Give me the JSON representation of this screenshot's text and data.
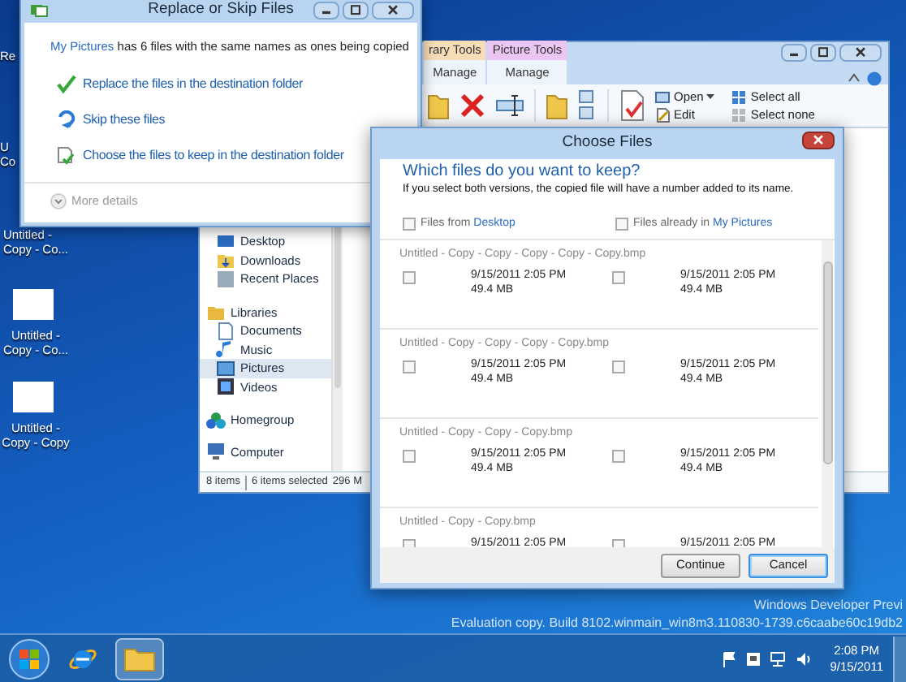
{
  "desktop": {
    "icons": [
      {
        "lines": [
          "Re"
        ]
      },
      {
        "lines": [
          "U",
          "Co"
        ]
      },
      {
        "lines": [
          "Untitled -",
          "Copy - Co..."
        ]
      },
      {
        "lines": [
          "Untitled -",
          "Copy - Co..."
        ]
      },
      {
        "lines": [
          "Untitled -",
          "Copy - Copy"
        ]
      }
    ],
    "watermark": [
      "Windows Developer Previ",
      "Evaluation copy. Build 8102.winmain_win8m3.110830-1739.c6caabe60c19db2"
    ]
  },
  "explorer": {
    "context_tabs": [
      {
        "label": "rary Tools",
        "color": "#f7dcb8",
        "group": "Manage"
      },
      {
        "label": "Picture Tools",
        "color": "#ecc6f2",
        "group": "Manage"
      }
    ],
    "ribbon": [
      {
        "kind": "open",
        "label": "Open"
      },
      {
        "kind": "edit",
        "label": "Edit"
      },
      {
        "kind": "select_all",
        "label": "Select all"
      },
      {
        "kind": "select_none",
        "label": "Select none"
      }
    ],
    "nav": [
      {
        "kind": "desktop",
        "label": "Desktop",
        "selected": false
      },
      {
        "kind": "downloads",
        "label": "Downloads",
        "selected": false
      },
      {
        "kind": "recent",
        "label": "Recent Places",
        "selected": false
      },
      {
        "kind": "libraries",
        "label": "Libraries",
        "selected": false
      },
      {
        "kind": "documents",
        "label": "Documents",
        "selected": false
      },
      {
        "kind": "music",
        "label": "Music",
        "selected": false
      },
      {
        "kind": "pictures",
        "label": "Pictures",
        "selected": true
      },
      {
        "kind": "videos",
        "label": "Videos",
        "selected": false
      },
      {
        "kind": "homegroup",
        "label": "Homegroup",
        "selected": false
      },
      {
        "kind": "computer",
        "label": "Computer",
        "selected": false
      }
    ],
    "status": [
      "8 items",
      "6 items selected",
      "296 M"
    ]
  },
  "replace_dialog": {
    "title": "Replace or Skip Files",
    "message_link": "My Pictures",
    "message": " has 6 files with the same names as ones being copied",
    "options": [
      {
        "kind": "replace",
        "label": "Replace the files in the destination folder"
      },
      {
        "kind": "skip",
        "label": "Skip these files"
      },
      {
        "kind": "choose",
        "label": "Choose the files to keep in the destination folder"
      }
    ],
    "more_details": "More details"
  },
  "choose_dialog": {
    "title": "Choose Files",
    "heading": "Which files do you want to keep?",
    "subtitle": "If you select both versions, the copied file will have a number added to its name.",
    "columns": [
      {
        "prefix": "Files from ",
        "link": "Desktop",
        "checked": false
      },
      {
        "prefix": "Files already in ",
        "link": "My Pictures",
        "checked": false
      }
    ],
    "files": [
      {
        "name": "Untitled - Copy - Copy - Copy - Copy - Copy.bmp",
        "versions": [
          {
            "date": "9/15/2011 2:05 PM",
            "size": "49.4 MB",
            "checked": false
          },
          {
            "date": "9/15/2011 2:05 PM",
            "size": "49.4 MB",
            "checked": false
          }
        ]
      },
      {
        "name": "Untitled - Copy - Copy - Copy - Copy.bmp",
        "versions": [
          {
            "date": "9/15/2011 2:05 PM",
            "size": "49.4 MB",
            "checked": false
          },
          {
            "date": "9/15/2011 2:05 PM",
            "size": "49.4 MB",
            "checked": false
          }
        ]
      },
      {
        "name": "Untitled - Copy - Copy - Copy.bmp",
        "versions": [
          {
            "date": "9/15/2011 2:05 PM",
            "size": "49.4 MB",
            "checked": false
          },
          {
            "date": "9/15/2011 2:05 PM",
            "size": "49.4 MB",
            "checked": false
          }
        ]
      },
      {
        "name": "Untitled - Copy - Copy.bmp",
        "versions": [
          {
            "date": "9/15/2011 2:05 PM",
            "checked": false
          },
          {
            "date": "9/15/2011 2:05 PM",
            "checked": false
          }
        ]
      }
    ],
    "buttons": [
      {
        "label": "Continue",
        "focused": false
      },
      {
        "label": "Cancel",
        "focused": true
      }
    ]
  },
  "taskbar": {
    "apps": [
      {
        "kind": "ie",
        "active": false
      },
      {
        "kind": "explorer",
        "active": true
      }
    ],
    "time": "2:08 PM",
    "date": "9/15/2011"
  }
}
